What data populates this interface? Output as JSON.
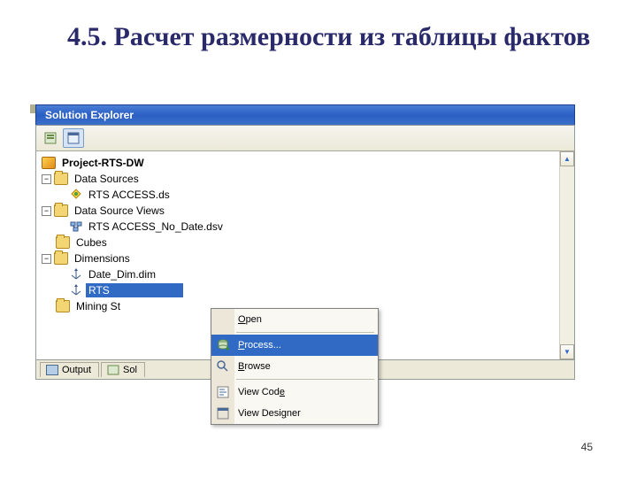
{
  "slide": {
    "title": "4.5. Расчет размерности из таблицы фактов",
    "page_number": "45"
  },
  "window": {
    "title": "Solution Explorer"
  },
  "toolbar": {
    "btn_properties": "properties",
    "btn_showall": "show-all"
  },
  "tree": {
    "project": "Project-RTS-DW",
    "data_sources": "Data Sources",
    "ds1": "RTS ACCESS.ds",
    "data_source_views": "Data Source Views",
    "dsv1": "RTS ACCESS_No_Date.dsv",
    "cubes": "Cubes",
    "dimensions": "Dimensions",
    "dim1": "Date_Dim.dim",
    "dim2_prefix": "RTS ",
    "mining": "Mining St"
  },
  "tabs": {
    "output": "Output",
    "solution": "Sol"
  },
  "context_menu": {
    "open": "Open",
    "process": "Process...",
    "browse": "Browse",
    "view_code": "View Code",
    "view_designer": "View Designer"
  }
}
